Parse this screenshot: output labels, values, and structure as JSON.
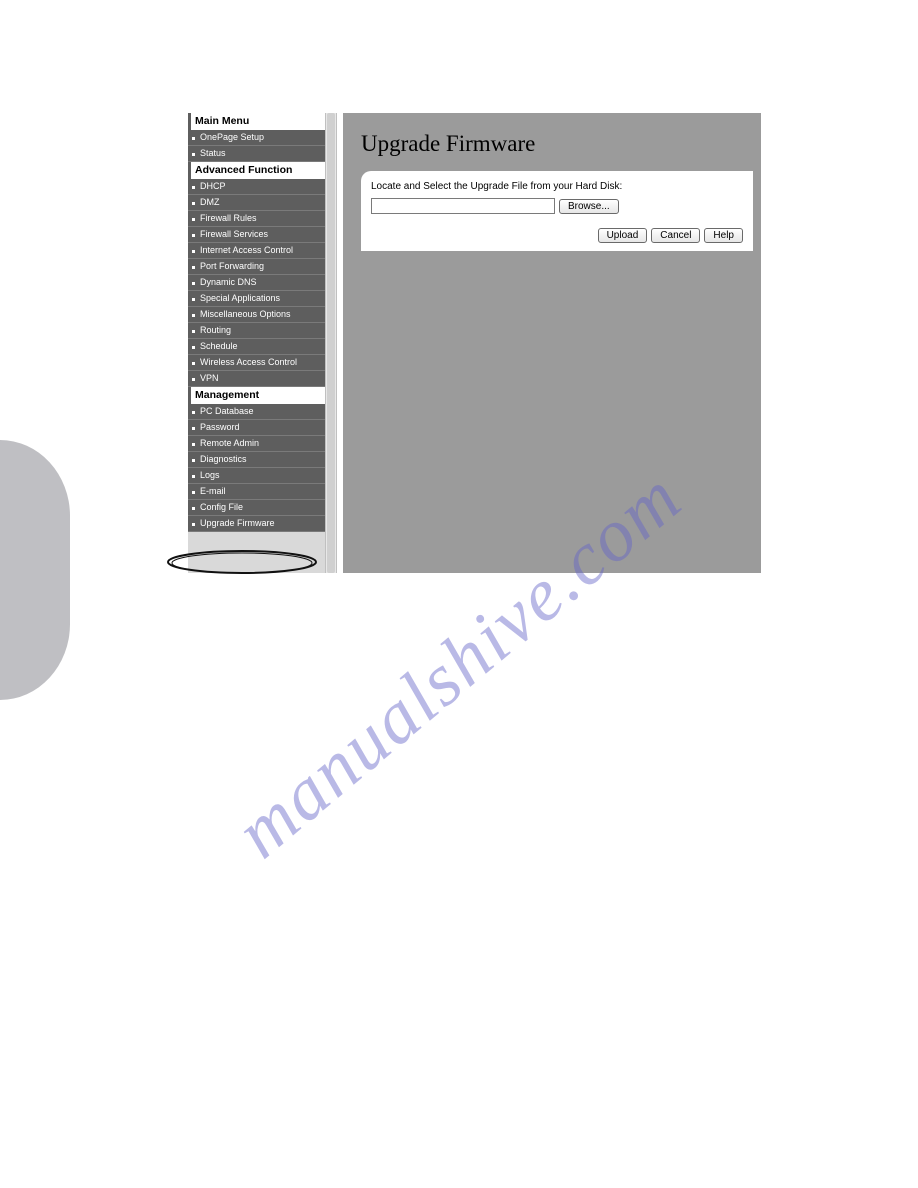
{
  "watermark": "manualshive.com",
  "sidebar": {
    "sections": [
      {
        "title": "Main Menu",
        "items": [
          "OnePage Setup",
          "Status"
        ]
      },
      {
        "title": "Advanced Function",
        "items": [
          "DHCP",
          "DMZ",
          "Firewall Rules",
          "Firewall Services",
          "Internet Access Control",
          "Port Forwarding",
          "Dynamic DNS",
          "Special Applications",
          "Miscellaneous Options",
          "Routing",
          "Schedule",
          "Wireless Access Control",
          "VPN"
        ]
      },
      {
        "title": "Management",
        "items": [
          "PC Database",
          "Password",
          "Remote Admin",
          "Diagnostics",
          "Logs",
          "E-mail",
          "Config File",
          "Upgrade Firmware"
        ]
      }
    ]
  },
  "main": {
    "title": "Upgrade Firmware",
    "instruction": "Locate and Select the Upgrade File from your Hard Disk:",
    "file_value": "",
    "buttons": {
      "browse": "Browse...",
      "upload": "Upload",
      "cancel": "Cancel",
      "help": "Help"
    }
  }
}
